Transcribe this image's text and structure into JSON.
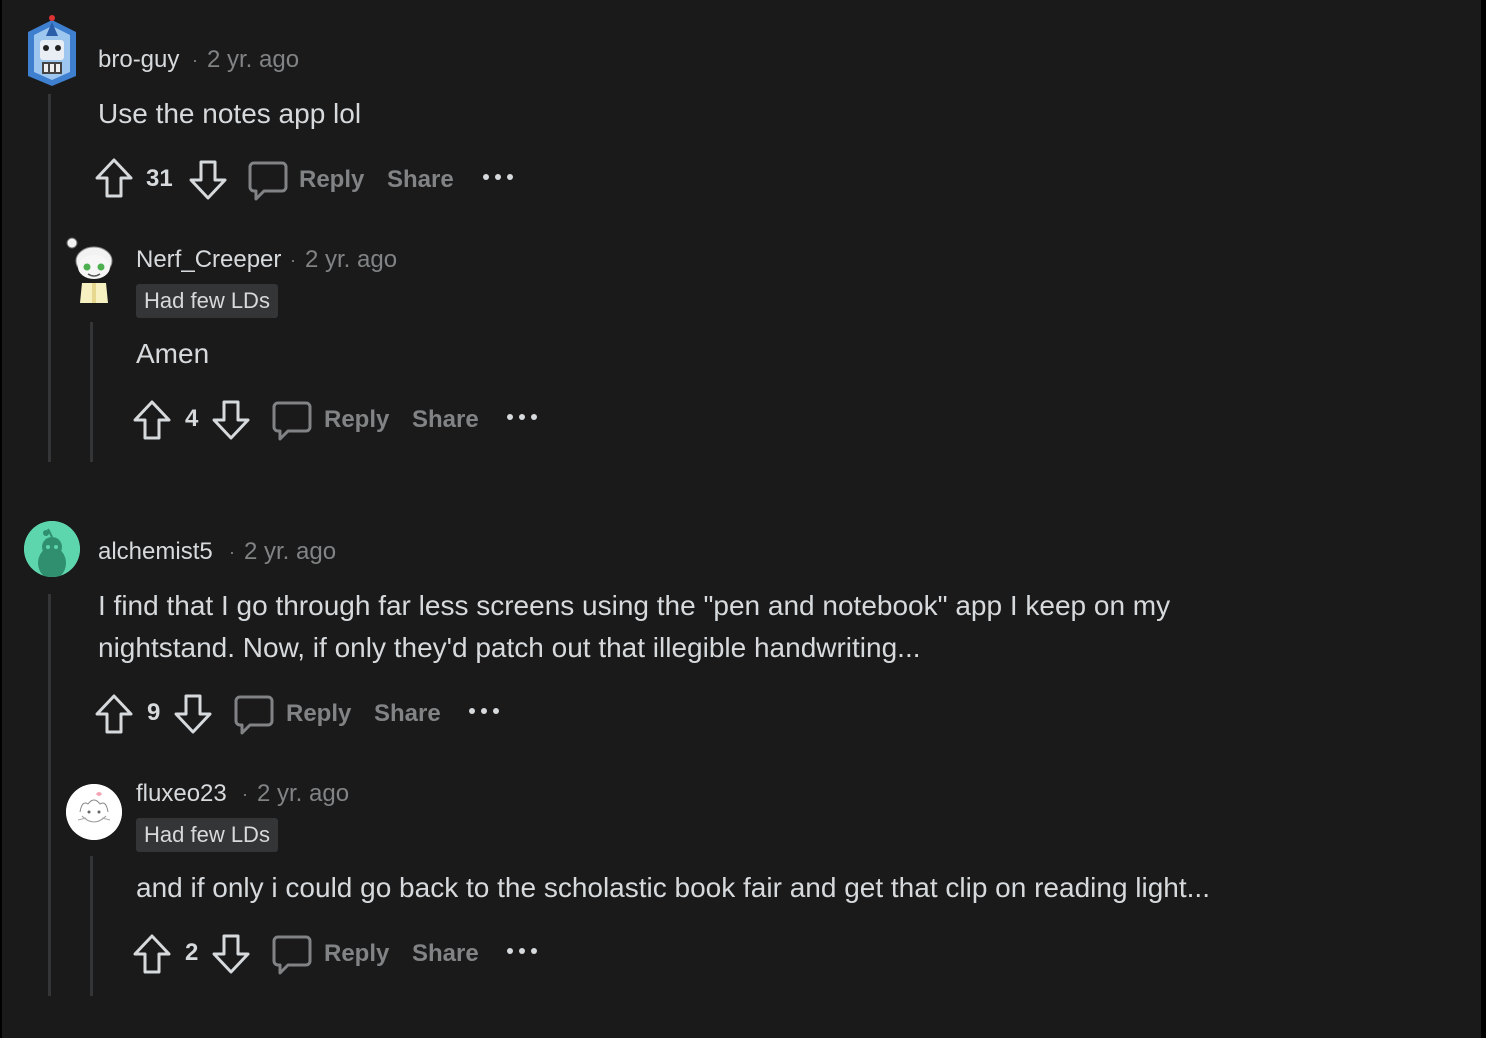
{
  "comments": [
    {
      "author": "bro-guy",
      "time": "2 yr. ago",
      "body": "Use the notes app lol",
      "votes": "31",
      "reply_label": "Reply",
      "share_label": "Share",
      "replies": [
        {
          "author": "Nerf_Creeper",
          "time": "2 yr. ago",
          "flair": "Had few LDs",
          "body": "Amen",
          "votes": "4",
          "reply_label": "Reply",
          "share_label": "Share"
        }
      ]
    },
    {
      "author": "alchemist5",
      "time": "2 yr. ago",
      "body_line1": "I find that I go through far less screens using the \"pen and notebook\" app I keep on my",
      "body_line2": "nightstand. Now, if only they'd patch out that illegible handwriting...",
      "votes": "9",
      "reply_label": "Reply",
      "share_label": "Share",
      "replies": [
        {
          "author": "fluxeo23",
          "time": "2 yr. ago",
          "flair": "Had few LDs",
          "body": "and if only i could go back to the scholastic book fair and get that clip on reading light...",
          "votes": "2",
          "reply_label": "Reply",
          "share_label": "Share"
        }
      ]
    }
  ],
  "separator": "·",
  "colors": {
    "background": "#1a1a1b",
    "text": "#d7dadc",
    "muted": "#818384",
    "thread_line": "#343536",
    "flair_bg": "#343536",
    "alchemist_avatar": "#5ed6ad"
  }
}
